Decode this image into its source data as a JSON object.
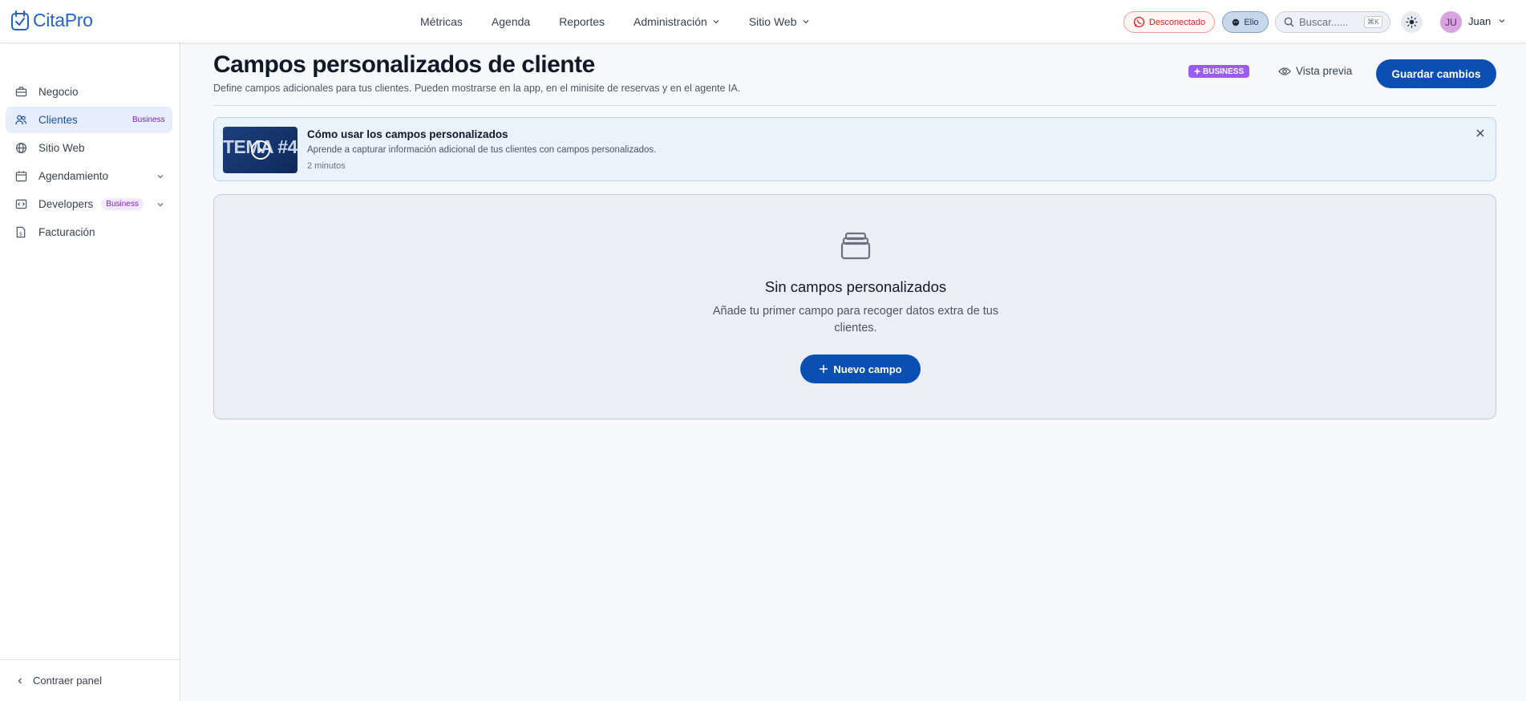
{
  "app": {
    "logo_text": "CitaPro"
  },
  "nav": {
    "items": [
      {
        "label": "Métricas"
      },
      {
        "label": "Agenda"
      },
      {
        "label": "Reportes"
      },
      {
        "label": "Administración"
      },
      {
        "label": "Sitio Web"
      }
    ]
  },
  "header": {
    "whatsapp_status": "Desconectado",
    "assistant_label": "Elio",
    "search_placeholder": "Buscar......",
    "search_shortcut": "⌘K",
    "user_initials": "JU",
    "user_name": "Juan"
  },
  "sidebar": {
    "items": [
      {
        "label": "Negocio"
      },
      {
        "label": "Clientes",
        "badge": "Business"
      },
      {
        "label": "Sitio Web"
      },
      {
        "label": "Agendamiento"
      },
      {
        "label": "Developers",
        "badge": "Business"
      },
      {
        "label": "Facturación"
      }
    ],
    "collapse_label": "Contraer panel"
  },
  "page": {
    "title": "Campos personalizados de cliente",
    "subtitle": "Define campos adicionales para tus clientes. Pueden mostrarse en la app, en el minisite de reservas y en el agente IA.",
    "business_tag": "BUSINESS",
    "preview_label": "Vista previa",
    "save_label": "Guardar cambios"
  },
  "video": {
    "thumb_text": "TEMA #4",
    "title": "Cómo usar los campos personalizados",
    "description": "Aprende a capturar información adicional de tus clientes con campos personalizados.",
    "duration": "2 minutos"
  },
  "empty_state": {
    "title": "Sin campos personalizados",
    "text": "Añade tu primer campo para recoger datos extra de tus clientes.",
    "button_label": "Nuevo campo"
  },
  "colors": {
    "primary": "#0b4fb2",
    "active_bg": "#e5eefa",
    "danger": "#d12424",
    "business_purple": "#9b5cf6"
  }
}
